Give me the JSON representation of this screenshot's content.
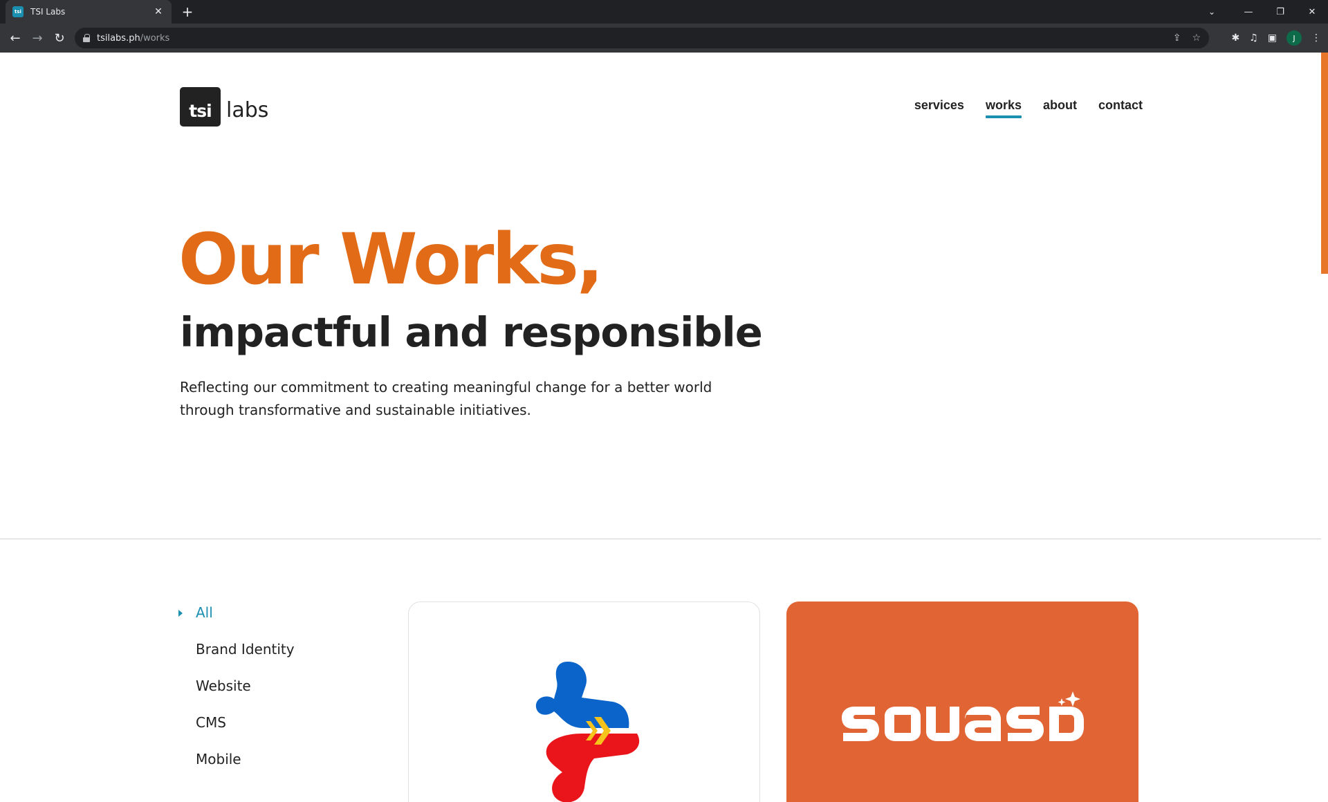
{
  "browser": {
    "tab_title": "TSI Labs",
    "tab_favicon": "tsi",
    "url_host": "tsilabs.ph",
    "url_path": "/works",
    "profile_initial": "J"
  },
  "site": {
    "logo_box_text": "tsi",
    "logo_text": "labs",
    "nav": [
      {
        "label": "services"
      },
      {
        "label": "works"
      },
      {
        "label": "about"
      },
      {
        "label": "contact"
      }
    ],
    "active_nav": "works",
    "accent_color": "#1b8fb0",
    "brand_orange": "#e16b17"
  },
  "hero": {
    "title": "Our Works,",
    "subtitle": "impactful and responsible",
    "description": "Reflecting our commitment to creating meaningful change for a better world through transformative and sustainable initiatives."
  },
  "filters": {
    "items": [
      "All",
      "Brand Identity",
      "Website",
      "CMS",
      "Mobile"
    ],
    "active": "All"
  },
  "cards": [
    {
      "logo": "ph-cross-logo-icon",
      "background": "#ffffff"
    },
    {
      "logo": "squasd-wordmark",
      "logo_text": "SQUASD",
      "background": "#e16434"
    }
  ]
}
